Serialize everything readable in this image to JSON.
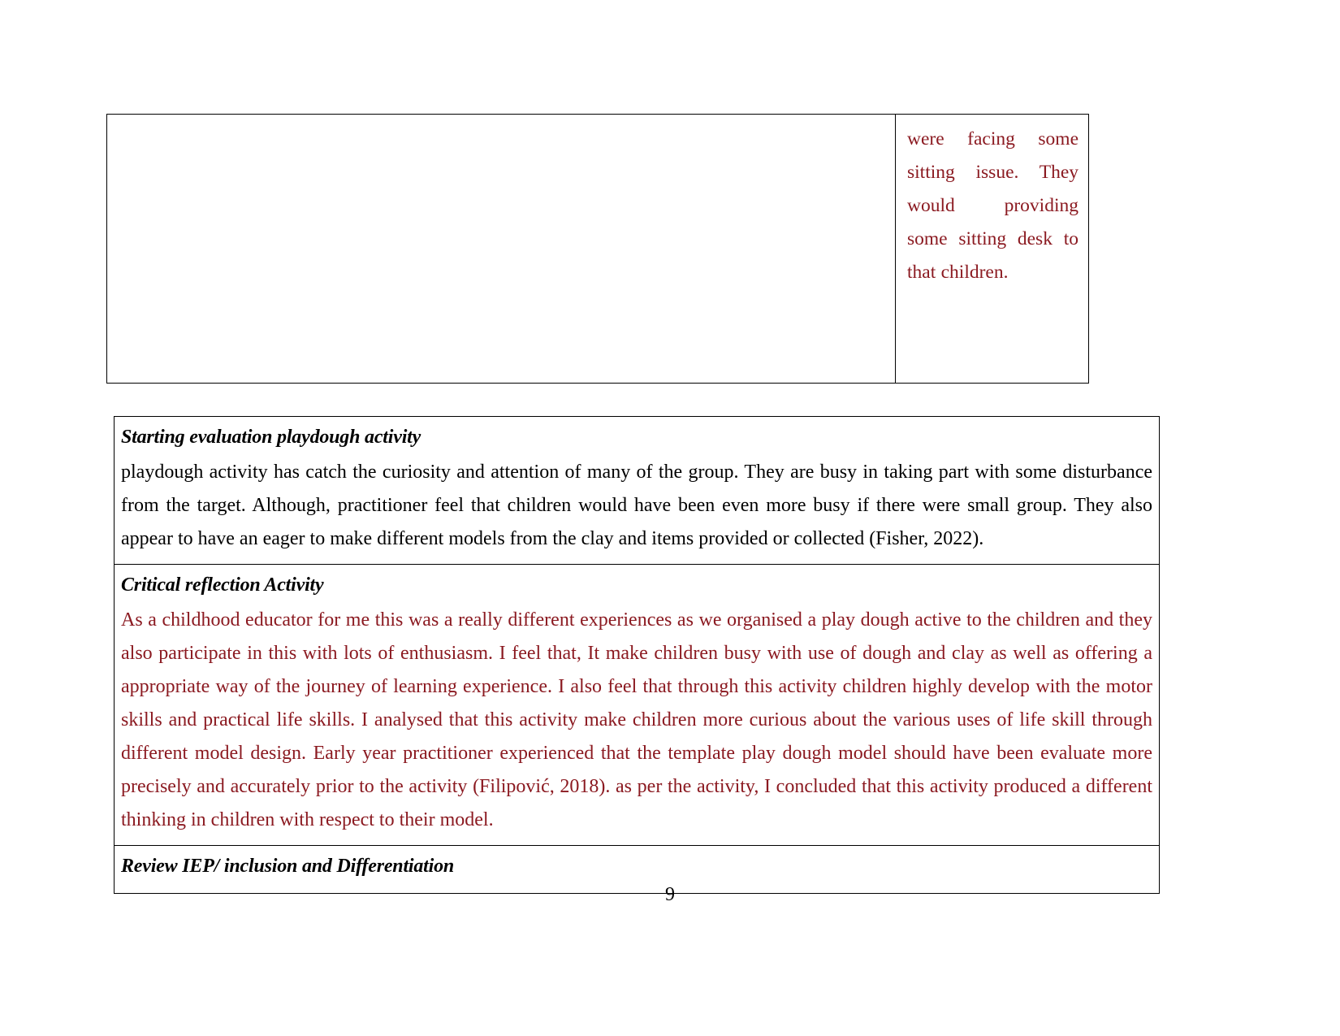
{
  "document": {
    "page_number": "9"
  },
  "top_table": {
    "left_cell_text": "",
    "right_cell_text": "were facing some sitting issue. They would providing some sitting desk to that children."
  },
  "sections": [
    {
      "heading": "Starting evaluation playdough activity",
      "heading_color": "#000000",
      "body": "playdough activity has catch the curiosity and attention of many of the group. They are busy in taking part with some disturbance from the target. Although, practitioner feel that children would have been even more busy if there were small group. They also appear to have an eager to make different models from the clay and items provided or collected (Fisher, 2022).",
      "body_color": "#000000"
    },
    {
      "heading": "Critical reflection Activity",
      "heading_color": "#000000",
      "body": "As a childhood educator for me this was a really different experiences as we organised a play dough active to the children and they also participate in this with lots of enthusiasm. I feel that, It make children busy with use of dough and clay as well as offering a appropriate way of the journey of learning experience. I also feel that through this activity children highly develop with the motor skills and practical life skills. I analysed that this activity make children more curious about the various uses of life skill through different model design. Early year practitioner experienced that the  template play dough model should have been evaluate more precisely and accurately prior to the activity (Filipović, 2018). as per the activity, I concluded that this activity produced a different thinking in children with respect to their model.",
      "body_color": "#8b1a21"
    },
    {
      "heading": "Review IEP/ inclusion and Differentiation",
      "heading_color": "#000000",
      "body": "",
      "body_color": "#000000"
    }
  ]
}
